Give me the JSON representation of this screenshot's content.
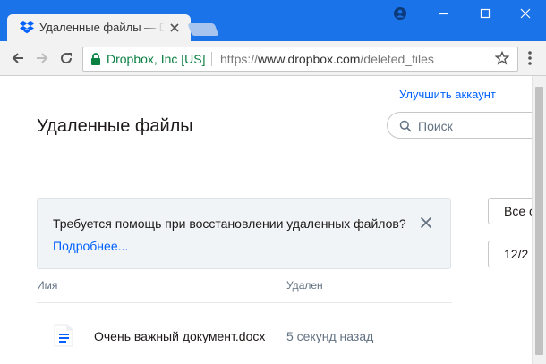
{
  "browser": {
    "tab_title": "Удаленные файлы — Dropbox",
    "secure_label": "Dropbox, Inc [US]",
    "url_scheme": "https://",
    "url_host": "www.dropbox.com",
    "url_path": "/deleted_files"
  },
  "page": {
    "upgrade_link": "Улучшить аккаунт",
    "title": "Удаленные файлы",
    "search_placeholder": "Поиск"
  },
  "banner": {
    "text": "Требуется помощь при восстановлении удаленных файлов?",
    "link": "Подробнее..."
  },
  "filters": {
    "scope": "Все о",
    "date": "12/2"
  },
  "table": {
    "columns": [
      "Имя",
      "Удален"
    ],
    "rows": [
      {
        "name": "Очень важный документ.docx",
        "deleted": "5 секунд назад",
        "icon": "document-icon"
      }
    ]
  },
  "colors": {
    "chrome_titlebar": "#1a73e8",
    "link": "#0061fe",
    "secure": "#0b8043",
    "banner_bg": "#f0f4f6"
  }
}
